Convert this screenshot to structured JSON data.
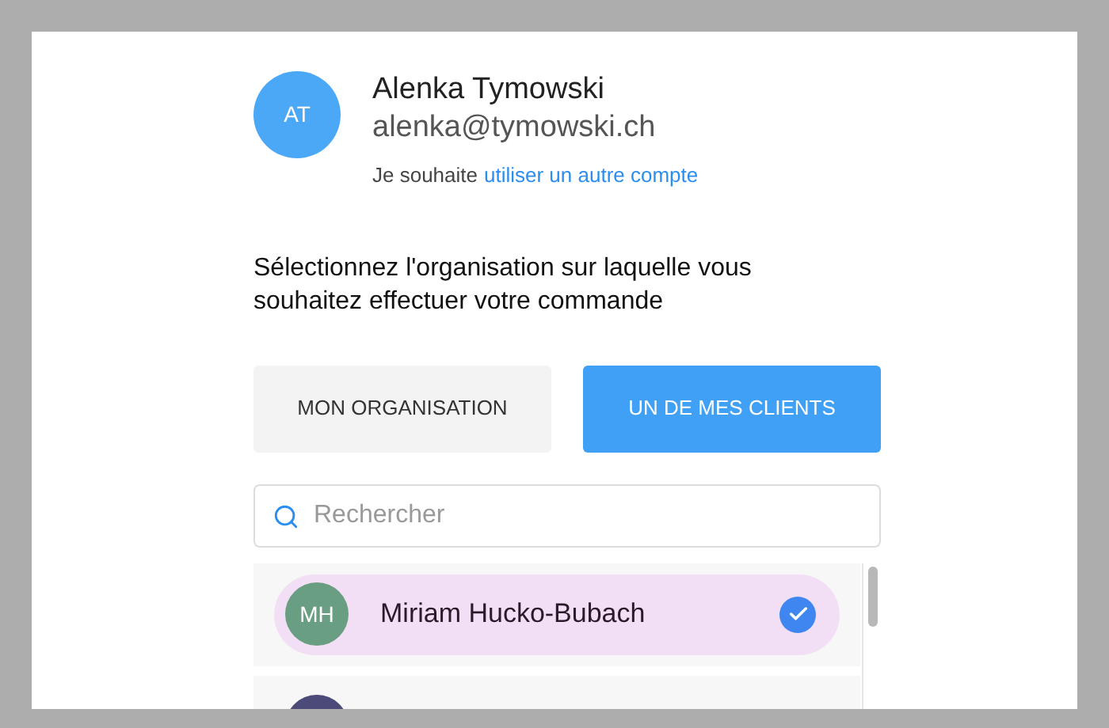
{
  "account": {
    "initials": "AT",
    "name": "Alenka Tymowski",
    "email": "alenka@tymowski.ch",
    "switch_prefix": "Je souhaite",
    "switch_link": "utiliser un autre compte"
  },
  "heading": "Sélectionnez l'organisation sur laquelle vous souhaitez effectuer votre commande",
  "toggle": [
    {
      "label": "MON ORGANISATION",
      "selected": false
    },
    {
      "label": "UN DE MES CLIENTS",
      "selected": true
    }
  ],
  "search": {
    "placeholder": "Rechercher"
  },
  "clients": [
    {
      "initials": "MH",
      "name": "Miriam Hucko-Bubach",
      "color": "#6a9e82",
      "selected": true
    },
    {
      "color": "#4b4a78",
      "selected": false
    }
  ]
}
